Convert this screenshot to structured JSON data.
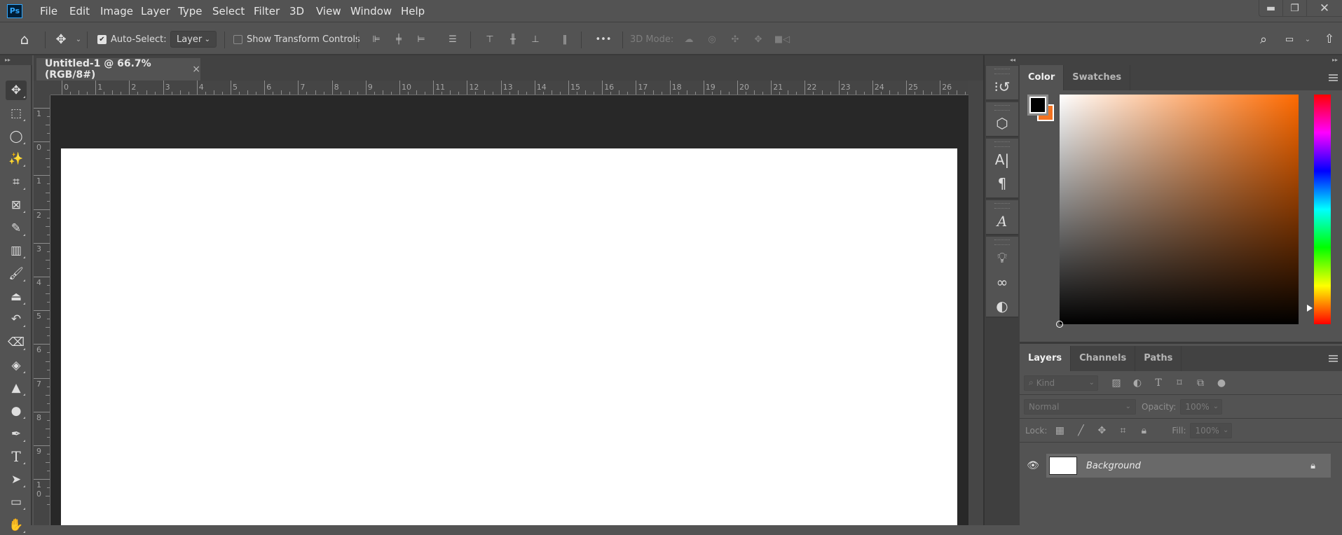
{
  "app": {
    "logo": "Ps"
  },
  "menu": [
    "File",
    "Edit",
    "Image",
    "Layer",
    "Type",
    "Select",
    "Filter",
    "3D",
    "View",
    "Window",
    "Help"
  ],
  "window_controls": {
    "minimize": "minimize-icon",
    "restore": "restore-icon",
    "close": "close-icon"
  },
  "options_bar": {
    "auto_select_label": "Auto-Select:",
    "auto_select_checked": true,
    "auto_select_target": "Layer",
    "show_transform_label": "Show Transform Controls",
    "show_transform_checked": false,
    "more_label": "•••",
    "mode_3d_label": "3D Mode:"
  },
  "document_tab": {
    "title": "Untitled-1 @ 66.7% (RGB/8#)",
    "close": "×"
  },
  "rulers": {
    "horizontal": [
      "0",
      "1",
      "2",
      "3",
      "4",
      "5",
      "6",
      "7",
      "8",
      "9",
      "10",
      "11",
      "12",
      "13",
      "14",
      "15",
      "16",
      "17",
      "18",
      "19",
      "20",
      "21",
      "22",
      "23",
      "24",
      "25",
      "26"
    ],
    "vertical": [
      "1",
      "0",
      "1",
      "2",
      "3",
      "4",
      "5",
      "6",
      "7",
      "8",
      "9",
      "10"
    ]
  },
  "color_panel": {
    "tabs": [
      "Color",
      "Swatches"
    ],
    "active_tab": "Color",
    "foreground_color": "#000000",
    "background_color": "#f47220",
    "hue_position": 0.93
  },
  "layers_panel": {
    "tabs": [
      "Layers",
      "Channels",
      "Paths"
    ],
    "active_tab": "Layers",
    "filter_kind": "Kind",
    "blend_mode": "Normal",
    "opacity_label": "Opacity:",
    "opacity": "100%",
    "lock_label": "Lock:",
    "fill_label": "Fill:",
    "fill": "100%",
    "layers": [
      {
        "name": "Background",
        "visible": true,
        "locked": true
      }
    ]
  }
}
